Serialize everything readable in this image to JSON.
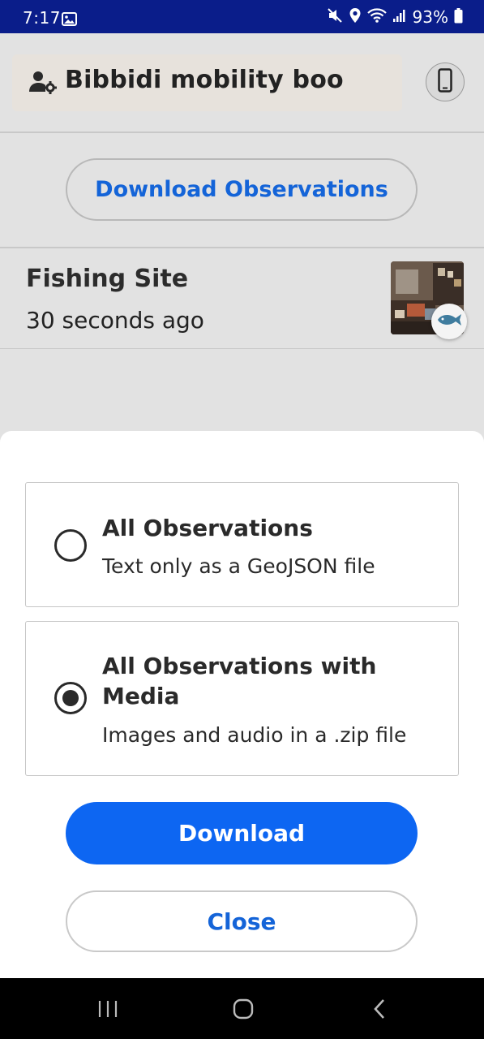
{
  "status_bar": {
    "time": "7:17",
    "battery_percent": "93%",
    "icons": [
      "image-icon",
      "mute-icon",
      "location-icon",
      "wifi-icon",
      "signal-icon",
      "battery-icon"
    ]
  },
  "header": {
    "project_name": "Bibbidi mobility boo",
    "project_icon": "user-gear-icon",
    "device_icon": "phone-icon"
  },
  "toolbar": {
    "download_observations_label": "Download Observations"
  },
  "observation": {
    "title": "Fishing Site",
    "time": "30 seconds ago",
    "category_icon": "fish-icon"
  },
  "sheet": {
    "options": [
      {
        "title": "All Observations",
        "description": "Text only as a GeoJSON file",
        "selected": false
      },
      {
        "title": "All Observations with Media",
        "description": "Images and audio in a .zip file",
        "selected": true
      }
    ],
    "download_label": "Download",
    "close_label": "Close"
  },
  "colors": {
    "status_bar": "#0a1d8a",
    "accent": "#0d66f2",
    "link_text": "#1464d8",
    "background": "#e2e2e2"
  },
  "nav_bar": {
    "icons": [
      "recent-apps-icon",
      "home-icon",
      "back-icon"
    ]
  }
}
